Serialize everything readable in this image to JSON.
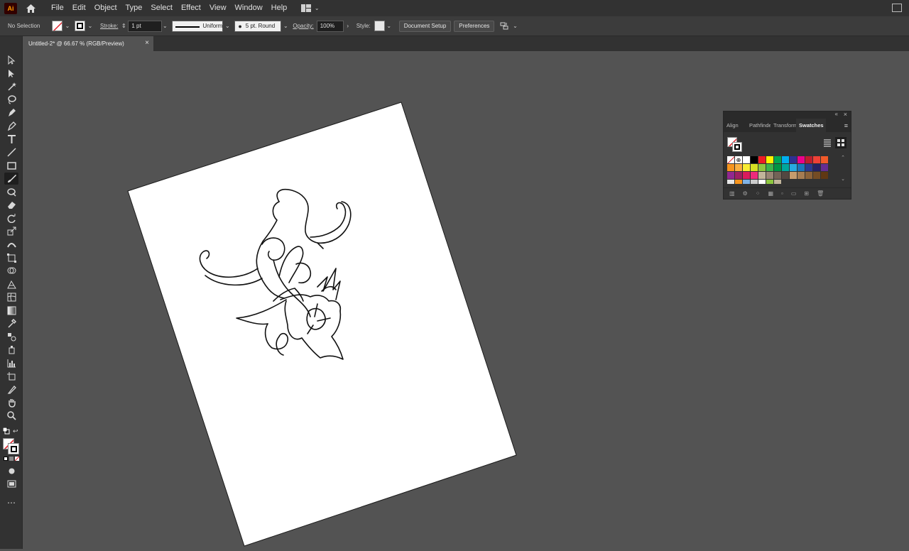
{
  "app": {
    "logo_text": "Ai"
  },
  "menu": [
    "File",
    "Edit",
    "Object",
    "Type",
    "Select",
    "Effect",
    "View",
    "Window",
    "Help"
  ],
  "control_bar": {
    "selection_label": "No Selection",
    "stroke_label": "Stroke:",
    "stroke_weight": "1 pt",
    "profile_label": "Uniform",
    "brush_label": "5 pt. Round",
    "opacity_label": "Opacity:",
    "opacity_value": "100%",
    "style_label": "Style:",
    "document_setup": "Document Setup",
    "preferences": "Preferences"
  },
  "document": {
    "tab_title": "Untitled-2* @ 66.67 % (RGB/Preview)",
    "close": "×"
  },
  "panel": {
    "tabs": [
      "Align",
      "Pathfinder",
      "Transform",
      "Swatches"
    ],
    "active_tab": "Swatches"
  },
  "swatch_colors": [
    [
      "#ffffff",
      "#ffffff",
      "#ffffff",
      "#000000",
      "#ed1c24",
      "#fff200",
      "#00a651",
      "#00aeef",
      "#2e3192",
      "#ec008c",
      "#be1e2d",
      "#ef4136",
      "#f15a29"
    ],
    [
      "#f7941d",
      "#fbb040",
      "#f9ed32",
      "#d7df23",
      "#8dc63f",
      "#39b54a",
      "#009444",
      "#00a79d",
      "#27aae1",
      "#1c75bc",
      "#2b3990",
      "#262262",
      "#662d91"
    ],
    [
      "#92278f",
      "#9e1f63",
      "#da1c5c",
      "#ee2a7b",
      "#c2b59b",
      "#998675",
      "#736357",
      "#534741",
      "#c69c6d",
      "#a67c52",
      "#8c6239",
      "#754c24",
      "#603813"
    ],
    [
      "#e6e6e6",
      "#f7941d",
      "#7fb2e5",
      "#cccccc",
      "#ffffff",
      "#8dc63f",
      "#c2b59b"
    ]
  ],
  "colors": {
    "ui_dark": "#323232",
    "canvas": "#535353",
    "accent": "#4a8bd6"
  }
}
